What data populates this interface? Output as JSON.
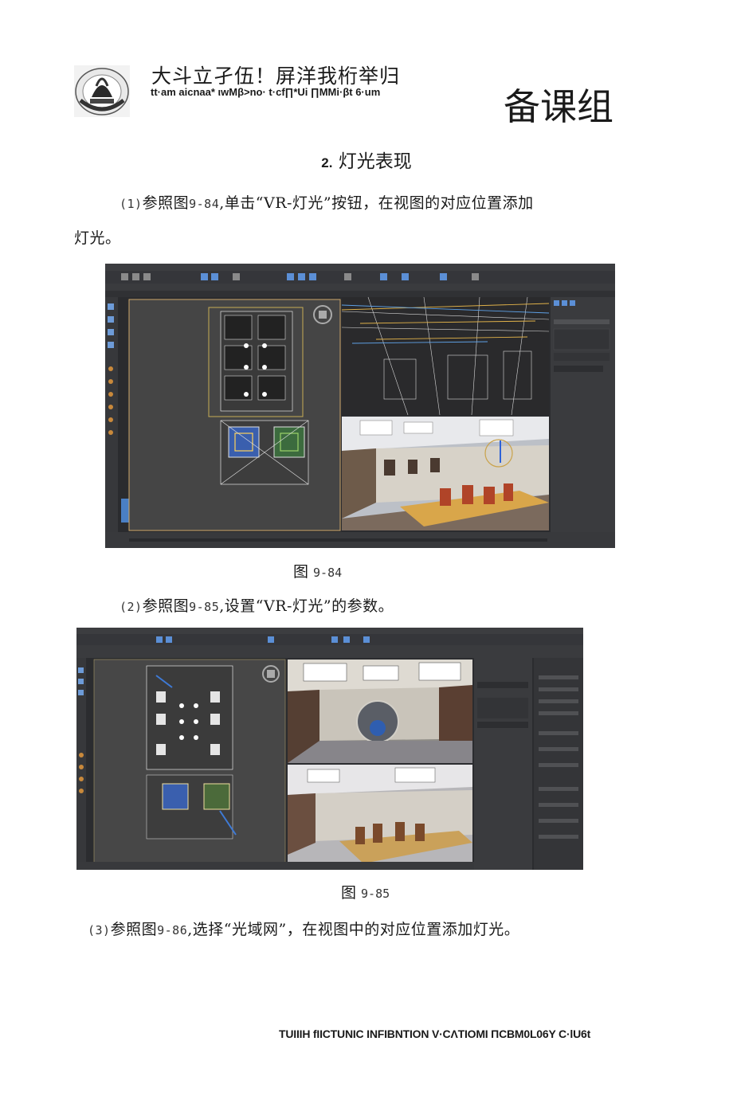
{
  "header": {
    "school_name_cn": "大斗立孑伍！屏洋我桁举归",
    "school_name_en": "tt·am aicnaa* ιwMβ>no· t·cf∏*Ui ∏MMi·βt 6·um",
    "group_name": "备课组",
    "logo_icon": "school-emblem-icon"
  },
  "section": {
    "number": "2.",
    "title": "灯光表现"
  },
  "steps": [
    {
      "num": "(1)",
      "text_a": "参照图",
      "ref": "9-84",
      "text_b": ",单击“VR-灯光”按钮，在视图的对应位置添加",
      "text_c": "灯光。"
    },
    {
      "num": "(2)",
      "text_a": "参照图",
      "ref": "9-85",
      "text_b": ",设置“VR-灯光”的参数。"
    },
    {
      "num": "(3)",
      "text_a": "参照图",
      "ref": "9-86",
      "text_b": ",选择“光域网”，在视图中的对应位置添加灯光。"
    }
  ],
  "figures": [
    {
      "label": "图",
      "number": "9-84"
    },
    {
      "label": "图",
      "number": "9-85"
    }
  ],
  "footer": {
    "text": "TUIIIH fIICTUNIC INFIBNTION V·CΛTIOMI ΠCBM0L06Y C·lU6t"
  }
}
